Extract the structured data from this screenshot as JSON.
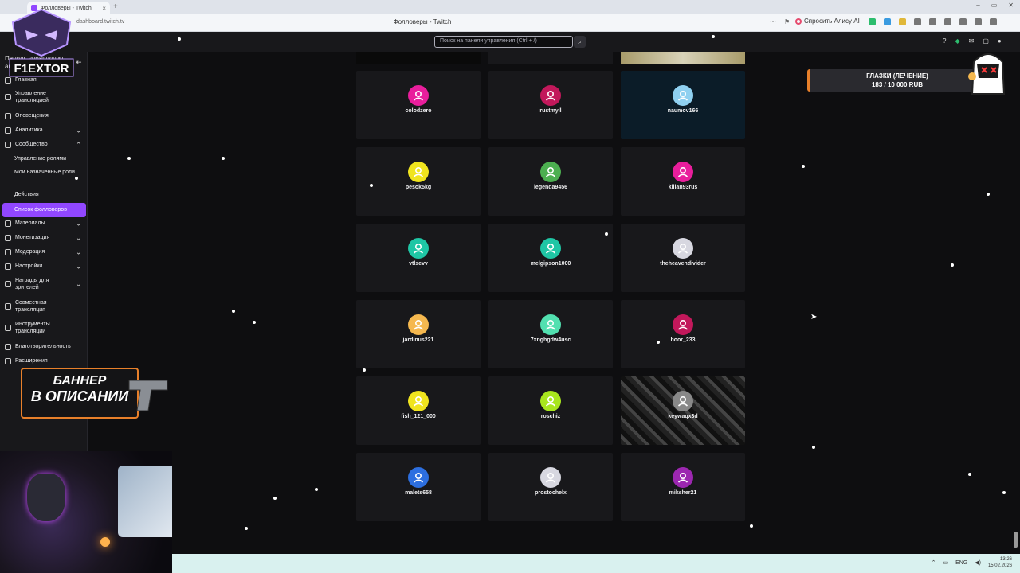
{
  "browser": {
    "tab_title": "Фолловеры - Twitch",
    "url": "dashboard.twitch.tv",
    "page_title": "Фолловеры - Twitch",
    "alice_label": "Спросить Алису AI"
  },
  "topnav": {
    "search_placeholder": "Поиск на панели управления (Ctrl + /)"
  },
  "sidebar": {
    "header": "Панель управления автора",
    "items": [
      {
        "label": "Главная"
      },
      {
        "label": "Управление трансляцией"
      },
      {
        "label": "Оповещения"
      },
      {
        "label": "Аналитика"
      },
      {
        "label": "Сообщество"
      },
      {
        "label": "Материалы"
      },
      {
        "label": "Монетизация"
      },
      {
        "label": "Модерация"
      },
      {
        "label": "Настройки"
      },
      {
        "label": "Награды для зрителей"
      },
      {
        "label": "Совместная трансляция"
      },
      {
        "label": "Инструменты трансляции"
      },
      {
        "label": "Благотворительность"
      },
      {
        "label": "Расширения"
      }
    ],
    "community_sub": [
      {
        "label": "Управление ролями"
      },
      {
        "label": "Мои назначенные роли"
      },
      {
        "label": "Действия"
      }
    ],
    "active": "Список фолловеров"
  },
  "overlay": {
    "logo_text": "F1EXTOR",
    "banner_line1": "БАННЕР",
    "banner_line2": "В ОПИСАНИИ",
    "alert_title": "ГЛАЗКИ (ЛЕЧЕНИЕ)",
    "alert_progress": "183 / 10 000 RUB"
  },
  "followers": [
    {
      "name": "colodzero",
      "color": "#e91e9c"
    },
    {
      "name": "rustmyll",
      "color": "#c2185b"
    },
    {
      "name": "naumov166",
      "color": "#8fd0f0"
    },
    {
      "name": "pesok5kg",
      "color": "#f0e41e"
    },
    {
      "name": "legenda9456",
      "color": "#4caf50"
    },
    {
      "name": "kilian93rus",
      "color": "#e91e9c"
    },
    {
      "name": "vtlsevv",
      "color": "#1fc6a5"
    },
    {
      "name": "melgipson1000",
      "color": "#1fc6a5"
    },
    {
      "name": "theheavendivider",
      "color": "#d7d7e0"
    },
    {
      "name": "jardinus221",
      "color": "#f5b84f"
    },
    {
      "name": "7xnghgdw4usc",
      "color": "#52e0b0"
    },
    {
      "name": "hoor_233",
      "color": "#c2185b"
    },
    {
      "name": "fish_121_000",
      "color": "#f0e41e"
    },
    {
      "name": "roschiz",
      "color": "#a8e61e"
    },
    {
      "name": "keywaqx3d",
      "color": "#888888"
    },
    {
      "name": "malets658",
      "color": "#2d6fe0"
    },
    {
      "name": "prostochelx",
      "color": "#d7d7e0"
    },
    {
      "name": "miksher21",
      "color": "#9c27b0"
    }
  ],
  "taskbar": {
    "lang": "ENG",
    "time": "13:26",
    "date": "15.02.2026"
  }
}
